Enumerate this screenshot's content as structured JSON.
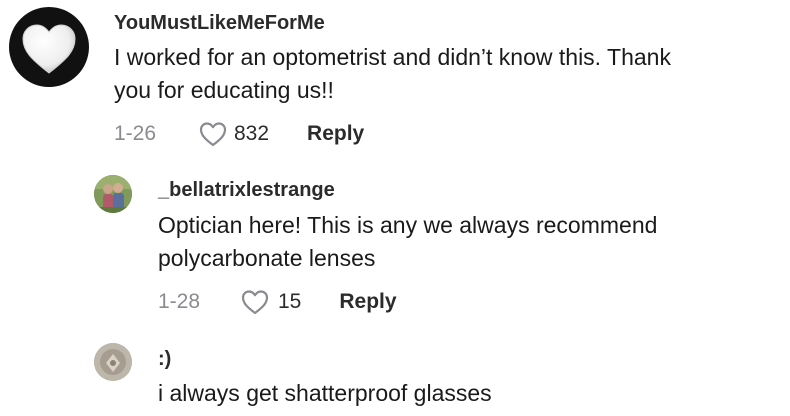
{
  "comments": [
    {
      "username": "YouMustLikeMeForMe",
      "text_line1": "I worked for an optometrist and didn’t know this. Thank",
      "text_line2": "you for educating us!!",
      "date": "1-26",
      "likes": "832",
      "reply_label": "Reply",
      "avatar_icon": "white-heart-icon"
    },
    {
      "username": "_bellatrixlestrange",
      "text_line1": "Optician here! This is any we always recommend",
      "text_line2": "polycarbonate lenses",
      "date": "1-28",
      "likes": "15",
      "reply_label": "Reply",
      "avatar_icon": "photo-avatar"
    },
    {
      "username": ":)",
      "text_line1": "i always get shatterproof glasses",
      "avatar_icon": "photo-avatar"
    }
  ],
  "colors": {
    "meta_gray": "#8a8b91",
    "text": "#1a1a1a",
    "avatar_bg_dark": "#111111"
  }
}
